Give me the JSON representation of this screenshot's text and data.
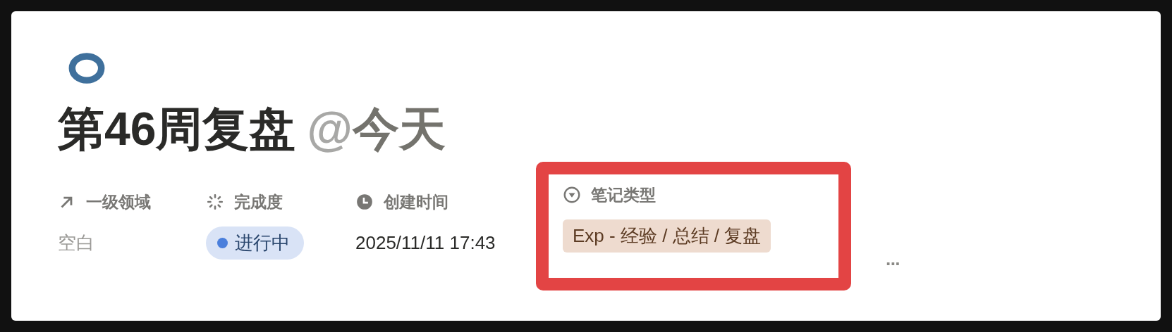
{
  "page": {
    "icon": {
      "color": "#3f709c"
    },
    "title": {
      "text": "第46周复盘",
      "mention": {
        "symbol": "@",
        "text": "今天"
      }
    },
    "properties": [
      {
        "kind": "relation",
        "label": "一级领域",
        "value": {
          "kind": "empty",
          "text": "空白"
        },
        "highlighted": false
      },
      {
        "kind": "status",
        "label": "完成度",
        "value": {
          "kind": "status",
          "text": "进行中",
          "color": "#4a7fdc"
        },
        "highlighted": false
      },
      {
        "kind": "created_time",
        "label": "创建时间",
        "value": {
          "kind": "text",
          "text": "2025/11/11 17:43"
        },
        "highlighted": false
      },
      {
        "kind": "select",
        "label": "笔记类型",
        "value": {
          "kind": "tag",
          "text": "Exp - 经验 / 总结 / 复盘",
          "color": "#eedbcf"
        },
        "highlighted": true
      }
    ],
    "more_button": {
      "text": "···"
    }
  }
}
